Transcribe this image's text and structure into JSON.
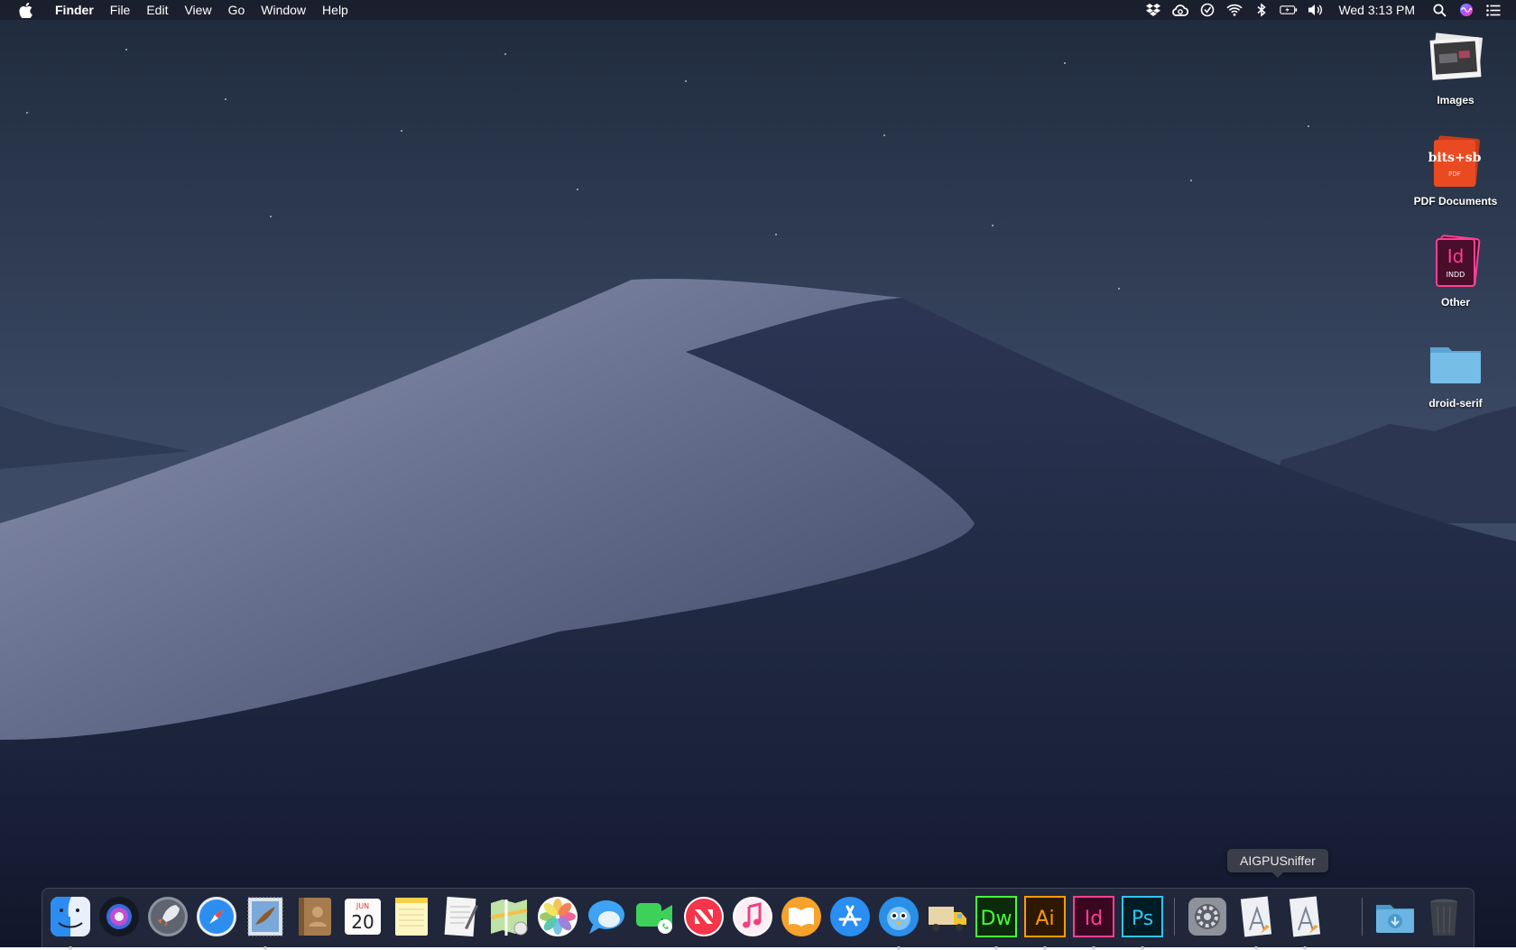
{
  "menubar": {
    "apple_icon": "apple-logo-icon",
    "app_name": "Finder",
    "menus": [
      "File",
      "Edit",
      "View",
      "Go",
      "Window",
      "Help"
    ],
    "status_icons": [
      "dropbox-icon",
      "creative-cloud-icon",
      "timing-icon",
      "wifi-icon",
      "bluetooth-icon",
      "battery-charging-icon",
      "volume-icon"
    ],
    "clock": "Wed 3:13 PM",
    "right_icons": [
      "spotlight-search-icon",
      "siri-icon",
      "notification-center-icon"
    ]
  },
  "desktop": {
    "icons": [
      {
        "label": "Images",
        "icon": "image-stack-icon"
      },
      {
        "label": "PDF Documents",
        "icon": "pdf-stack-icon",
        "badge": "bits+sb",
        "sub": "PDF"
      },
      {
        "label": "Other",
        "icon": "indesign-document-icon",
        "badge": "Id",
        "sub": "INDD"
      },
      {
        "label": "droid-serif",
        "icon": "folder-icon"
      }
    ]
  },
  "tooltip": {
    "text": "AIGPUSniffer"
  },
  "dock": {
    "items": [
      {
        "name": "finder",
        "running": true
      },
      {
        "name": "siri",
        "running": false
      },
      {
        "name": "launchpad",
        "running": false
      },
      {
        "name": "safari",
        "running": false
      },
      {
        "name": "mail",
        "running": true
      },
      {
        "name": "contacts",
        "running": false
      },
      {
        "name": "calendar",
        "running": false,
        "month": "JUN",
        "day": "20"
      },
      {
        "name": "notes",
        "running": false
      },
      {
        "name": "textedit",
        "running": false
      },
      {
        "name": "maps",
        "running": false
      },
      {
        "name": "photos",
        "running": false
      },
      {
        "name": "messages",
        "running": false
      },
      {
        "name": "facetime",
        "running": false
      },
      {
        "name": "news",
        "running": false
      },
      {
        "name": "itunes",
        "running": false
      },
      {
        "name": "books",
        "running": false
      },
      {
        "name": "app-store",
        "running": false
      },
      {
        "name": "tweetbot",
        "running": true
      },
      {
        "name": "transmit",
        "running": false
      },
      {
        "name": "dreamweaver",
        "running": true,
        "text": "Dw"
      },
      {
        "name": "illustrator",
        "running": true,
        "text": "Ai"
      },
      {
        "name": "indesign",
        "running": true,
        "text": "Id"
      },
      {
        "name": "photoshop",
        "running": true,
        "text": "Ps"
      },
      {
        "name": "system-preferences",
        "running": false
      },
      {
        "name": "aigpusniffer",
        "running": true
      },
      {
        "name": "xcode-document",
        "running": true
      },
      {
        "name": "downloads-folder",
        "running": false
      },
      {
        "name": "trash",
        "running": false
      }
    ]
  },
  "colors": {
    "accent_dw": "#46ff35",
    "accent_ai": "#ff9a00",
    "accent_id": "#ff3f94",
    "accent_ps": "#31c5f0"
  }
}
